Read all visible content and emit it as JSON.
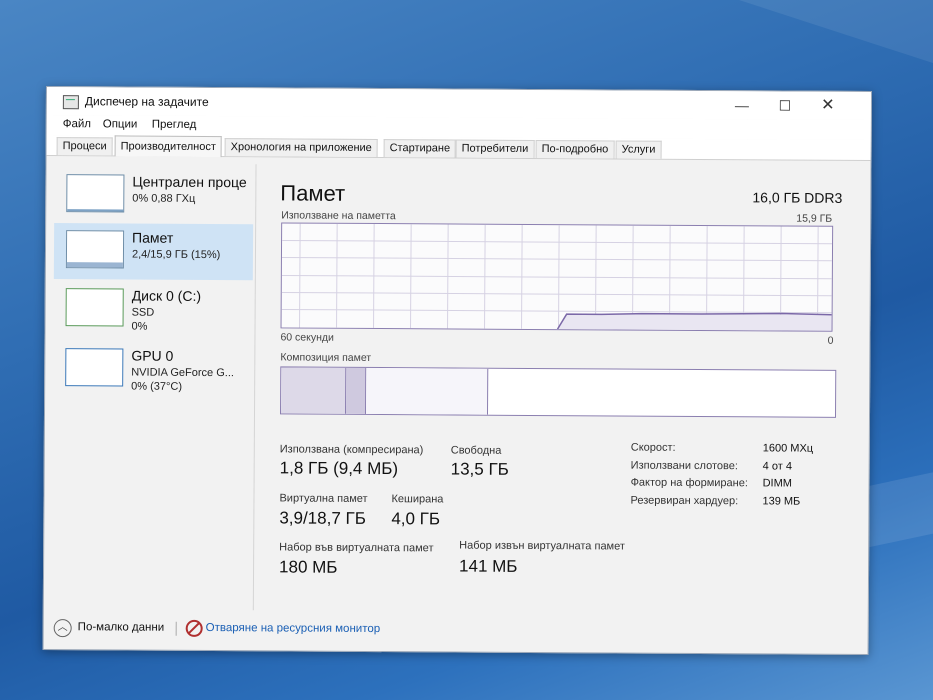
{
  "window": {
    "title": "Диспечер на задачите"
  },
  "menu": [
    "Файл",
    "Опции",
    "Преглед"
  ],
  "tabs": [
    "Процеси",
    "Производителност",
    "Хронология на приложение",
    "Стартиране",
    "Потребители",
    "По-подробно",
    "Услуги"
  ],
  "active_tab": "Производителност",
  "sidebar": [
    {
      "title": "Централен проце",
      "line1": "0% 0,88 ГХц",
      "line2": "",
      "usage": 0.02
    },
    {
      "title": "Памет",
      "line1": "2,4/15,9 ГБ (15%)",
      "line2": "",
      "usage": 0.15
    },
    {
      "title": "Диск 0 (C:)",
      "line1": "SSD",
      "line2": "0%",
      "usage": 0.0
    },
    {
      "title": "GPU 0",
      "line1": "NVIDIA GeForce G...",
      "line2": "0% (37°C)",
      "usage": 0.0
    }
  ],
  "main": {
    "heading": "Памет",
    "spec": "16,0 ГБ DDR3",
    "usage_label": "Използване на паметта",
    "usage_max": "15,9 ГБ",
    "time_left": "60 секунди",
    "time_right": "0",
    "composition_label": "Композиция памет",
    "stats": {
      "in_use_label": "Използвана (компресирана)",
      "in_use_value": "1,8 ГБ (9,4 МБ)",
      "available_label": "Свободна",
      "available_value": "13,5 ГБ",
      "committed_label": "Виртуална памет",
      "committed_value": "3,9/18,7 ГБ",
      "cached_label": "Кеширана",
      "cached_value": "4,0 ГБ",
      "paged_label": "Набор във виртуалната памет",
      "paged_value": "180 МБ",
      "nonpaged_label": "Набор извън виртуалната памет",
      "nonpaged_value": "141 МБ"
    },
    "details": [
      {
        "label": "Скорост:",
        "value": "1600 MХц"
      },
      {
        "label": "Използвани слотове:",
        "value": "4 от 4"
      },
      {
        "label": "Фактор на формиране:",
        "value": "DIMM"
      },
      {
        "label": "Резервиран хардуер:",
        "value": "139 МБ"
      }
    ]
  },
  "footer": {
    "fewer": "По-малко данни",
    "monitor": "Отваряне на ресурсния монитор"
  }
}
